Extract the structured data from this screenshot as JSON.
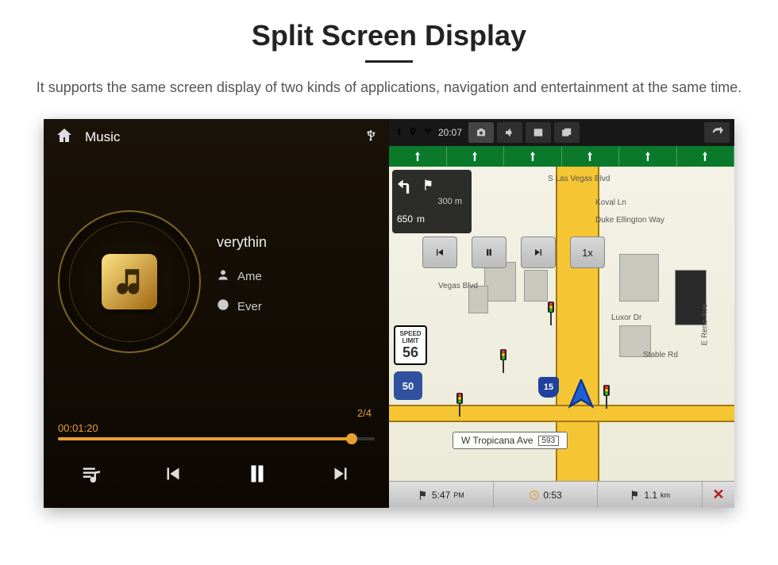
{
  "page": {
    "title": "Split Screen Display",
    "subtitle": "It supports the same screen display of two kinds of applications, navigation and entertainment at the same time."
  },
  "music": {
    "top_label": "Music",
    "usb_label": "USB",
    "track_title": "verythin",
    "artist": "Ame",
    "album": "Ever",
    "track_counter": "2/4",
    "elapsed": "00:01:20",
    "icons": {
      "home": "home-icon",
      "usb": "usb-icon",
      "artist": "person-icon",
      "album": "disc-icon",
      "playlist": "playlist-icon",
      "prev": "skip-prev-icon",
      "pause": "pause-icon",
      "next": "skip-next-icon"
    }
  },
  "nav": {
    "status": {
      "time": "20:07",
      "icons": {
        "bt": "bluetooth-icon",
        "gps": "location-icon",
        "wifi": "wifi-icon",
        "screenshot": "camera-icon",
        "volume": "volume-icon",
        "close_app": "close-app-icon",
        "recent": "recent-apps-icon",
        "back": "back-icon"
      }
    },
    "turn": {
      "sub_distance": "300 m",
      "main_distance": "650",
      "main_unit": "m"
    },
    "playback": {
      "speed": "1x"
    },
    "speed_limit": {
      "label_top": "SPEED",
      "label_mid": "LIMIT",
      "value": "56"
    },
    "highway_shield": "50",
    "interstate": "15",
    "streets": {
      "s_las_vegas": "S Las Vegas Blvd",
      "koval": "Koval Ln",
      "duke": "Duke Ellington Way",
      "luxor": "Luxor Dr",
      "stable": "Stable Rd",
      "reno": "E Reno Ave",
      "tropicana": "W Tropicana Ave",
      "tropicana_no": "593",
      "vegas_blvd": "Vegas Blvd"
    },
    "bottom": {
      "eta": "5:47",
      "eta_unit": "PM",
      "duration": "0:53",
      "distance": "1.1",
      "distance_unit": "km",
      "close": "✕"
    }
  }
}
